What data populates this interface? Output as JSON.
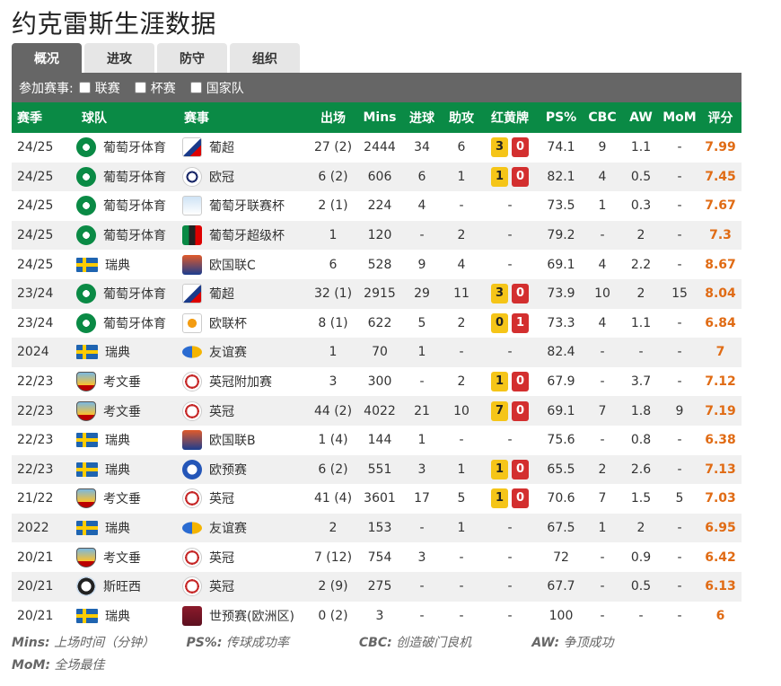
{
  "title": "约克雷斯生涯数据",
  "tabs": [
    "概况",
    "进攻",
    "防守",
    "组织"
  ],
  "filter": {
    "label": "参加赛事:",
    "options": [
      "联赛",
      "杯赛",
      "国家队"
    ]
  },
  "columns": [
    "赛季",
    "球队",
    "赛事",
    "出场",
    "Mins",
    "进球",
    "助攻",
    "红黄牌",
    "PS%",
    "CBC",
    "AW",
    "MoM",
    "评分"
  ],
  "rows": [
    {
      "season": "24/25",
      "team": "葡萄牙体育",
      "team_icon": "sporting",
      "comp": "葡超",
      "comp_icon": "comp-pl",
      "apps": "27 (2)",
      "mins": "2444",
      "goals": "34",
      "assists": "6",
      "yellow": "3",
      "red": "0",
      "ps": "74.1",
      "cbc": "9",
      "aw": "1.1",
      "mom": "-",
      "rating": "7.99"
    },
    {
      "season": "24/25",
      "team": "葡萄牙体育",
      "team_icon": "sporting",
      "comp": "欧冠",
      "comp_icon": "comp-ucl",
      "apps": "6 (2)",
      "mins": "606",
      "goals": "6",
      "assists": "1",
      "yellow": "1",
      "red": "0",
      "ps": "82.1",
      "cbc": "4",
      "aw": "0.5",
      "mom": "-",
      "rating": "7.45"
    },
    {
      "season": "24/25",
      "team": "葡萄牙体育",
      "team_icon": "sporting",
      "comp": "葡萄牙联赛杯",
      "comp_icon": "comp-cup",
      "apps": "2 (1)",
      "mins": "224",
      "goals": "4",
      "assists": "-",
      "cards": "-",
      "ps": "73.5",
      "cbc": "1",
      "aw": "0.3",
      "mom": "-",
      "rating": "7.67"
    },
    {
      "season": "24/25",
      "team": "葡萄牙体育",
      "team_icon": "sporting",
      "comp": "葡萄牙超级杯",
      "comp_icon": "comp-super",
      "apps": "1",
      "mins": "120",
      "goals": "-",
      "assists": "2",
      "cards": "-",
      "ps": "79.2",
      "cbc": "-",
      "aw": "2",
      "mom": "-",
      "rating": "7.3"
    },
    {
      "season": "24/25",
      "team": "瑞典",
      "team_icon": "sweden",
      "comp": "欧国联C",
      "comp_icon": "comp-nl",
      "apps": "6",
      "mins": "528",
      "goals": "9",
      "assists": "4",
      "cards": "-",
      "ps": "69.1",
      "cbc": "4",
      "aw": "2.2",
      "mom": "-",
      "rating": "8.67"
    },
    {
      "season": "23/24",
      "team": "葡萄牙体育",
      "team_icon": "sporting",
      "comp": "葡超",
      "comp_icon": "comp-pl",
      "apps": "32 (1)",
      "mins": "2915",
      "goals": "29",
      "assists": "11",
      "yellow": "3",
      "red": "0",
      "ps": "73.9",
      "cbc": "10",
      "aw": "2",
      "mom": "15",
      "rating": "8.04"
    },
    {
      "season": "23/24",
      "team": "葡萄牙体育",
      "team_icon": "sporting",
      "comp": "欧联杯",
      "comp_icon": "comp-uel",
      "apps": "8 (1)",
      "mins": "622",
      "goals": "5",
      "assists": "2",
      "yellow": "0",
      "red": "1",
      "ps": "73.3",
      "cbc": "4",
      "aw": "1.1",
      "mom": "-",
      "rating": "6.84"
    },
    {
      "season": "2024",
      "team": "瑞典",
      "team_icon": "sweden",
      "comp": "友谊赛",
      "comp_icon": "comp-friendly",
      "apps": "1",
      "mins": "70",
      "goals": "1",
      "assists": "-",
      "cards": "-",
      "ps": "82.4",
      "cbc": "-",
      "aw": "-",
      "mom": "-",
      "rating": "7"
    },
    {
      "season": "22/23",
      "team": "考文垂",
      "team_icon": "coventry",
      "comp": "英冠附加赛",
      "comp_icon": "comp-efl",
      "apps": "3",
      "mins": "300",
      "goals": "-",
      "assists": "2",
      "yellow": "1",
      "red": "0",
      "ps": "67.9",
      "cbc": "-",
      "aw": "3.7",
      "mom": "-",
      "rating": "7.12"
    },
    {
      "season": "22/23",
      "team": "考文垂",
      "team_icon": "coventry",
      "comp": "英冠",
      "comp_icon": "comp-efl",
      "apps": "44 (2)",
      "mins": "4022",
      "goals": "21",
      "assists": "10",
      "yellow": "7",
      "red": "0",
      "ps": "69.1",
      "cbc": "7",
      "aw": "1.8",
      "mom": "9",
      "rating": "7.19"
    },
    {
      "season": "22/23",
      "team": "瑞典",
      "team_icon": "sweden",
      "comp": "欧国联B",
      "comp_icon": "comp-nl",
      "apps": "1 (4)",
      "mins": "144",
      "goals": "1",
      "assists": "-",
      "cards": "-",
      "ps": "75.6",
      "cbc": "-",
      "aw": "0.8",
      "mom": "-",
      "rating": "6.38"
    },
    {
      "season": "22/23",
      "team": "瑞典",
      "team_icon": "sweden",
      "comp": "欧预赛",
      "comp_icon": "comp-euro",
      "apps": "6 (2)",
      "mins": "551",
      "goals": "3",
      "assists": "1",
      "yellow": "1",
      "red": "0",
      "ps": "65.5",
      "cbc": "2",
      "aw": "2.6",
      "mom": "-",
      "rating": "7.13"
    },
    {
      "season": "21/22",
      "team": "考文垂",
      "team_icon": "coventry",
      "comp": "英冠",
      "comp_icon": "comp-efl",
      "apps": "41 (4)",
      "mins": "3601",
      "goals": "17",
      "assists": "5",
      "yellow": "1",
      "red": "0",
      "ps": "70.6",
      "cbc": "7",
      "aw": "1.5",
      "mom": "5",
      "rating": "7.03"
    },
    {
      "season": "2022",
      "team": "瑞典",
      "team_icon": "sweden",
      "comp": "友谊赛",
      "comp_icon": "comp-friendly",
      "apps": "2",
      "mins": "153",
      "goals": "-",
      "assists": "1",
      "cards": "-",
      "ps": "67.5",
      "cbc": "1",
      "aw": "2",
      "mom": "-",
      "rating": "6.95"
    },
    {
      "season": "20/21",
      "team": "考文垂",
      "team_icon": "coventry",
      "comp": "英冠",
      "comp_icon": "comp-efl",
      "apps": "7 (12)",
      "mins": "754",
      "goals": "3",
      "assists": "-",
      "cards": "-",
      "ps": "72",
      "cbc": "-",
      "aw": "0.9",
      "mom": "-",
      "rating": "6.42"
    },
    {
      "season": "20/21",
      "team": "斯旺西",
      "team_icon": "swansea",
      "comp": "英冠",
      "comp_icon": "comp-efl",
      "apps": "2 (9)",
      "mins": "275",
      "goals": "-",
      "assists": "-",
      "cards": "-",
      "ps": "67.7",
      "cbc": "-",
      "aw": "0.5",
      "mom": "-",
      "rating": "6.13"
    },
    {
      "season": "20/21",
      "team": "瑞典",
      "team_icon": "sweden",
      "comp": "世预赛(欧洲区)",
      "comp_icon": "comp-wcq",
      "apps": "0 (2)",
      "mins": "3",
      "goals": "-",
      "assists": "-",
      "cards": "-",
      "ps": "100",
      "cbc": "-",
      "aw": "-",
      "mom": "-",
      "rating": "6"
    }
  ],
  "legend": [
    {
      "key": "Mins:",
      "desc": "上场时间（分钟）"
    },
    {
      "key": "PS%:",
      "desc": "传球成功率"
    },
    {
      "key": "CBC:",
      "desc": "创造破门良机"
    },
    {
      "key": "AW:",
      "desc": "争顶成功"
    },
    {
      "key": "MoM:",
      "desc": "全场最佳"
    }
  ],
  "colors": {
    "header_green": "#0a8a45",
    "rating_orange": "#e06b14",
    "yellow_card": "#f5c518",
    "red_card": "#d32f2f"
  }
}
